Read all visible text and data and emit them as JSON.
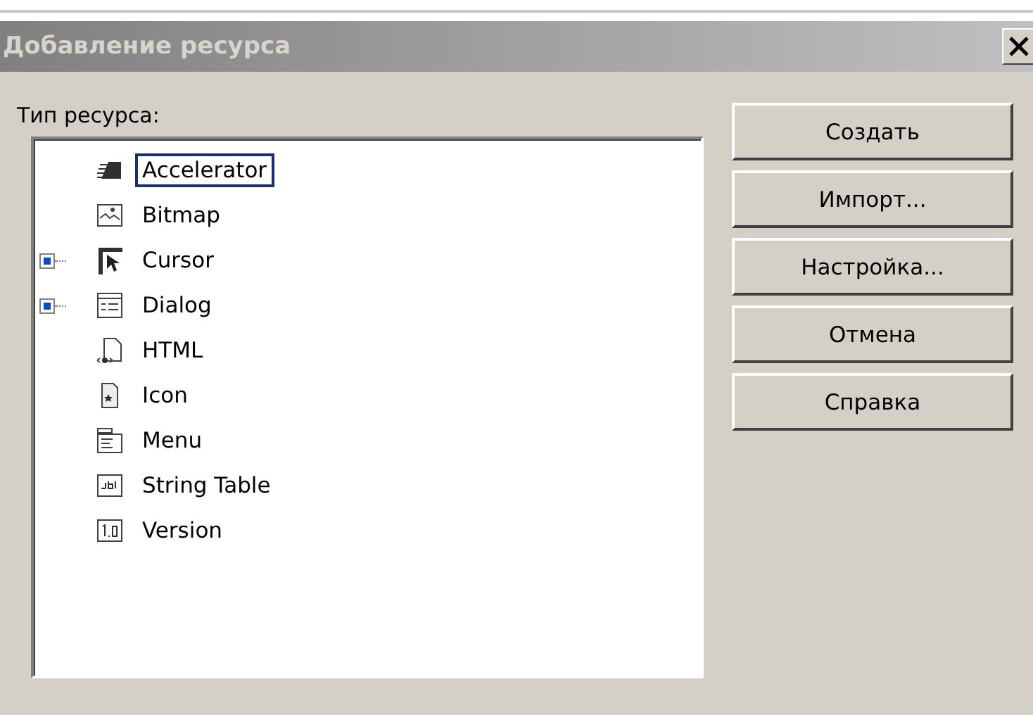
{
  "window": {
    "title": "Добавление ресурса"
  },
  "tree": {
    "label": "Тип ресурса:",
    "items": [
      {
        "kind": "accelerator",
        "label": "Accelerator",
        "selected": true
      },
      {
        "kind": "bitmap",
        "label": "Bitmap",
        "selected": false
      },
      {
        "kind": "cursor",
        "label": "Cursor",
        "selected": false,
        "expanded": false
      },
      {
        "kind": "dialog",
        "label": "Dialog",
        "selected": false,
        "expanded": false
      },
      {
        "kind": "html",
        "label": "HTML",
        "selected": false
      },
      {
        "kind": "icon",
        "label": "Icon",
        "selected": false
      },
      {
        "kind": "menu",
        "label": "Menu",
        "selected": false
      },
      {
        "kind": "string",
        "label": "String Table",
        "selected": false
      },
      {
        "kind": "version",
        "label": "Version",
        "selected": false
      }
    ]
  },
  "buttons": [
    "Создать",
    "Импорт...",
    "Настройка...",
    "Отмена",
    "Справка"
  ]
}
